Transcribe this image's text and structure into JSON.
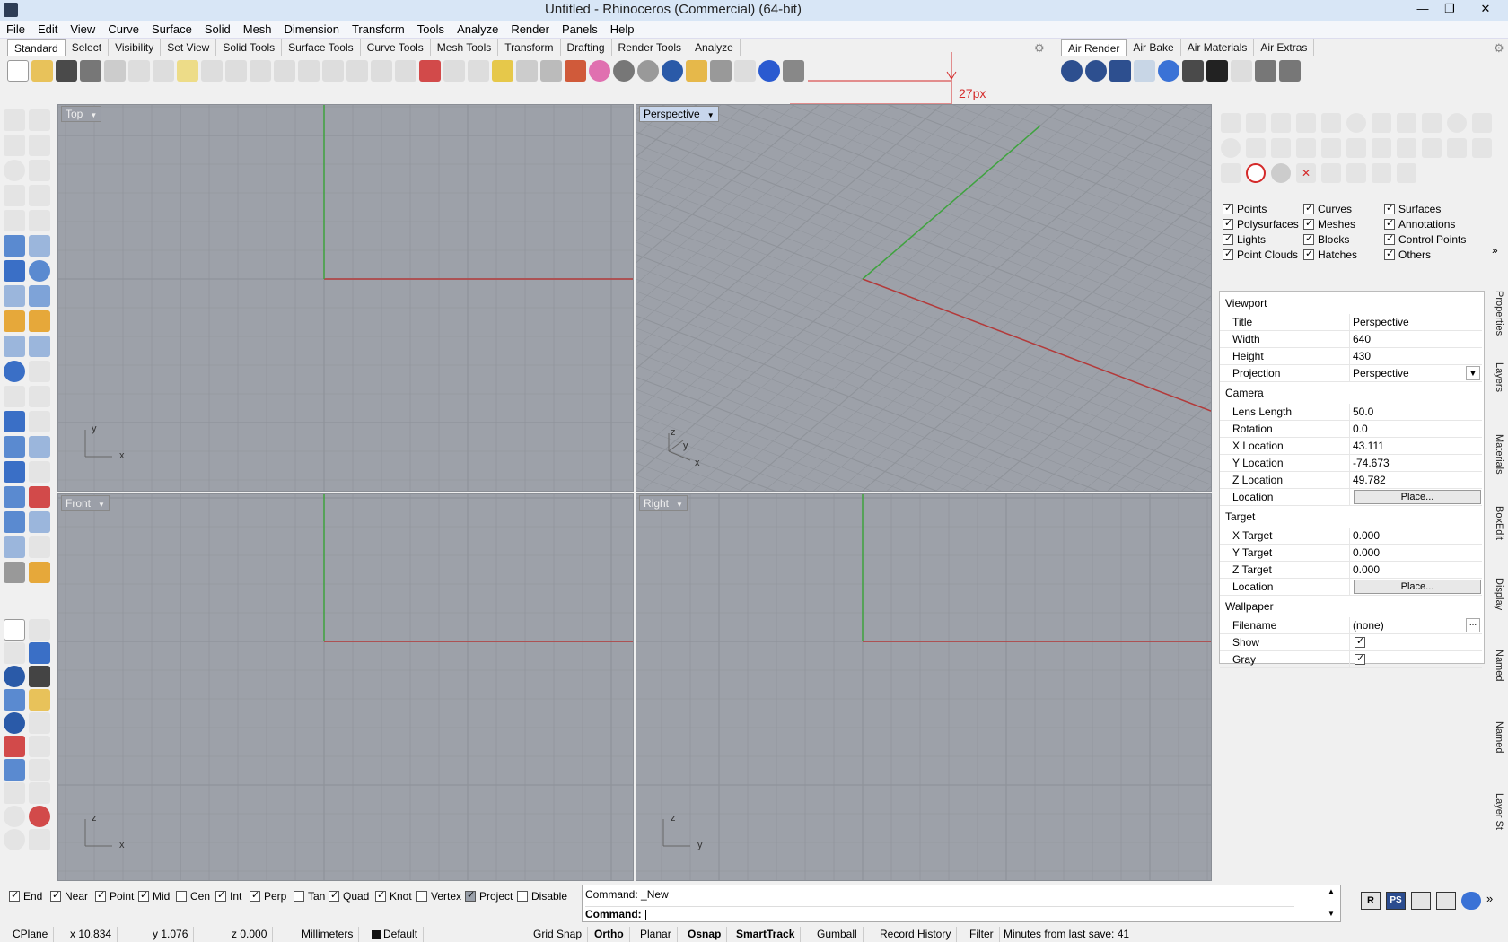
{
  "window": {
    "title": "Untitled - Rhinoceros (Commercial) (64-bit)"
  },
  "menu": [
    "File",
    "Edit",
    "View",
    "Curve",
    "Surface",
    "Solid",
    "Mesh",
    "Dimension",
    "Transform",
    "Tools",
    "Analyze",
    "Render",
    "Panels",
    "Help"
  ],
  "tabs_left": [
    "Standard",
    "Select",
    "Visibility",
    "Set View",
    "Solid Tools",
    "Surface Tools",
    "Curve Tools",
    "Mesh Tools",
    "Transform",
    "Drafting",
    "Render Tools",
    "Analyze"
  ],
  "tabs_right": [
    "Air Render",
    "Air Bake",
    "Air Materials",
    "Air Extras"
  ],
  "annotation": {
    "text": "27px",
    "color": "#d42a2a"
  },
  "viewports": {
    "top": "Top",
    "perspective": "Perspective",
    "front": "Front",
    "right": "Right"
  },
  "axes": {
    "x": "x",
    "y": "y",
    "z": "z"
  },
  "filters": [
    {
      "label": "Points",
      "checked": true
    },
    {
      "label": "Curves",
      "checked": true
    },
    {
      "label": "Surfaces",
      "checked": true
    },
    {
      "label": "Polysurfaces",
      "checked": true
    },
    {
      "label": "Meshes",
      "checked": true
    },
    {
      "label": "Annotations",
      "checked": true
    },
    {
      "label": "Lights",
      "checked": true
    },
    {
      "label": "Blocks",
      "checked": true
    },
    {
      "label": "Control Points",
      "checked": true
    },
    {
      "label": "Point Clouds",
      "checked": true
    },
    {
      "label": "Hatches",
      "checked": true
    },
    {
      "label": "Others",
      "checked": true
    }
  ],
  "props": {
    "viewport_header": "Viewport",
    "title_k": "Title",
    "title_v": "Perspective",
    "width_k": "Width",
    "width_v": "640",
    "height_k": "Height",
    "height_v": "430",
    "projection_k": "Projection",
    "projection_v": "Perspective",
    "camera_header": "Camera",
    "lens_k": "Lens Length",
    "lens_v": "50.0",
    "rotation_k": "Rotation",
    "rotation_v": "0.0",
    "xloc_k": "X Location",
    "xloc_v": "43.111",
    "yloc_k": "Y Location",
    "yloc_v": "-74.673",
    "zloc_k": "Z Location",
    "zloc_v": "49.782",
    "loc_k": "Location",
    "place_btn": "Place...",
    "target_header": "Target",
    "xt_k": "X Target",
    "xt_v": "0.000",
    "yt_k": "Y Target",
    "yt_v": "0.000",
    "zt_k": "Z Target",
    "zt_v": "0.000",
    "wall_header": "Wallpaper",
    "file_k": "Filename",
    "file_v": "(none)",
    "file_btn": "...",
    "show_k": "Show",
    "gray_k": "Gray"
  },
  "vtabs": [
    "Properties",
    "Layers",
    "Materials",
    "BoxEdit",
    "Display",
    "Named",
    "Named",
    "Layer St"
  ],
  "osnaps": [
    {
      "label": "End",
      "checked": true
    },
    {
      "label": "Near",
      "checked": true
    },
    {
      "label": "Point",
      "checked": true
    },
    {
      "label": "Mid",
      "checked": true
    },
    {
      "label": "Cen",
      "checked": false
    },
    {
      "label": "Int",
      "checked": true
    },
    {
      "label": "Perp",
      "checked": true
    },
    {
      "label": "Tan",
      "checked": false
    },
    {
      "label": "Quad",
      "checked": true
    },
    {
      "label": "Knot",
      "checked": true
    },
    {
      "label": "Vertex",
      "checked": false
    },
    {
      "label": "Project",
      "checked": true
    },
    {
      "label": "Disable",
      "checked": false
    }
  ],
  "command": {
    "history": "Command: _New",
    "prompt": "Command:"
  },
  "status": {
    "cplane": "CPlane",
    "x": "x 10.834",
    "y": "y 1.076",
    "z": "z 0.000",
    "units": "Millimeters",
    "layer": "Default",
    "grid_snap": "Grid Snap",
    "ortho": "Ortho",
    "planar": "Planar",
    "osnap": "Osnap",
    "smarttrack": "SmartTrack",
    "gumball": "Gumball",
    "record": "Record History",
    "filter": "Filter",
    "save": "Minutes from last save: 41"
  },
  "right_buttons": [
    "R",
    "PS"
  ],
  "colors": {
    "grid": "#9da1a9",
    "gridline": "#8f939a",
    "xaxis": "#b33a3a",
    "yaxis": "#3fa33f",
    "accent": "#c8d6ec"
  }
}
